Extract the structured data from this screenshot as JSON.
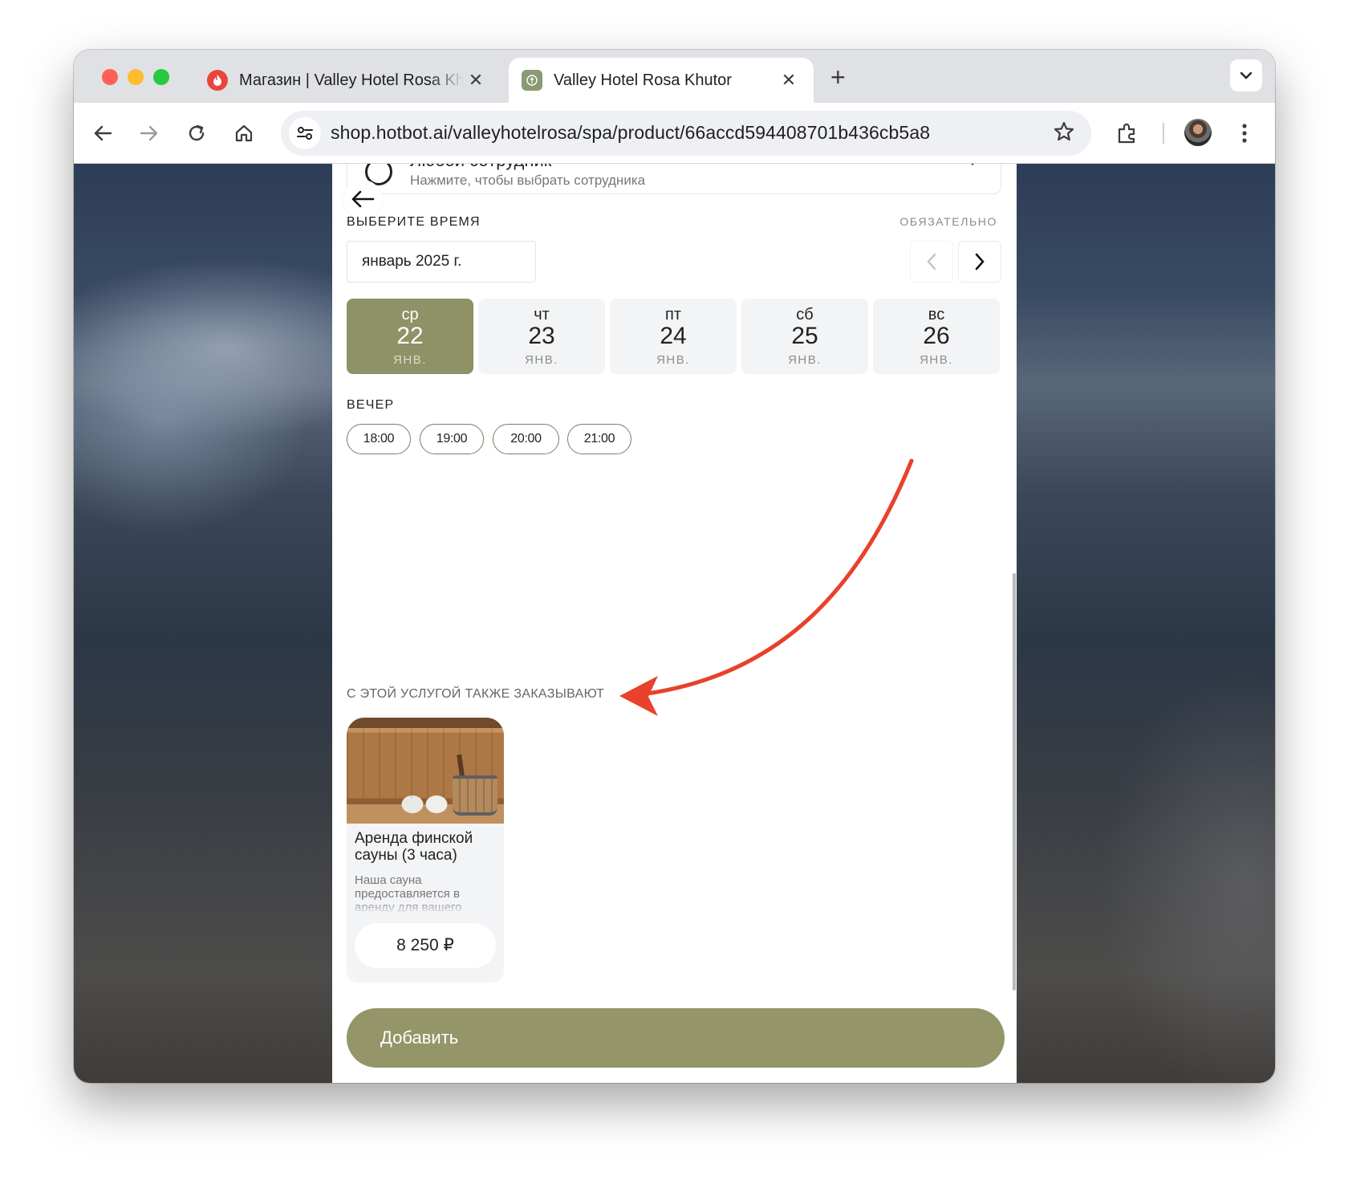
{
  "browser": {
    "tabs": [
      {
        "title": "Магазин | Valley Hotel Rosa Khutor",
        "active": false,
        "favicon": "flame-icon"
      },
      {
        "title": "Valley Hotel Rosa Khutor",
        "active": true,
        "favicon": "hotel-logo-icon"
      }
    ],
    "close_glyph": "✕",
    "new_tab_glyph": "+",
    "url": "shop.hotbot.ai/valleyhotelrosa/spa/product/66accd594408701b436cb5a8"
  },
  "page": {
    "staff": {
      "name": "Любой сотрудник",
      "hint": "Нажмите, чтобы выбрать сотрудника"
    },
    "time_section": {
      "label": "ВЫБЕРИТЕ ВРЕМЯ",
      "required": "ОБЯЗАТЕЛЬНО",
      "month": "январь 2025 г."
    },
    "days": [
      {
        "weekday": "ср",
        "day": "22",
        "month": "ЯНВ.",
        "selected": true
      },
      {
        "weekday": "чт",
        "day": "23",
        "month": "ЯНВ.",
        "selected": false
      },
      {
        "weekday": "пт",
        "day": "24",
        "month": "ЯНВ.",
        "selected": false
      },
      {
        "weekday": "сб",
        "day": "25",
        "month": "ЯНВ.",
        "selected": false
      },
      {
        "weekday": "вс",
        "day": "26",
        "month": "ЯНВ.",
        "selected": false
      }
    ],
    "evening_label": "ВЕЧЕР",
    "slots": [
      "18:00",
      "19:00",
      "20:00",
      "21:00"
    ],
    "related": {
      "label": "С ЭТОЙ УСЛУГОЙ ТАКЖЕ ЗАКАЗЫВАЮТ",
      "cards": [
        {
          "title": "Аренда финской сауны (3 часа)",
          "description": "Наша сауна предоставляется в аренду для вашего уединенного отдыха",
          "price": "8 250 ₽"
        }
      ]
    },
    "add_button": "Добавить"
  },
  "colors": {
    "accent": "#8f9166",
    "button": "#949669",
    "annotation_arrow": "#e8412c"
  }
}
